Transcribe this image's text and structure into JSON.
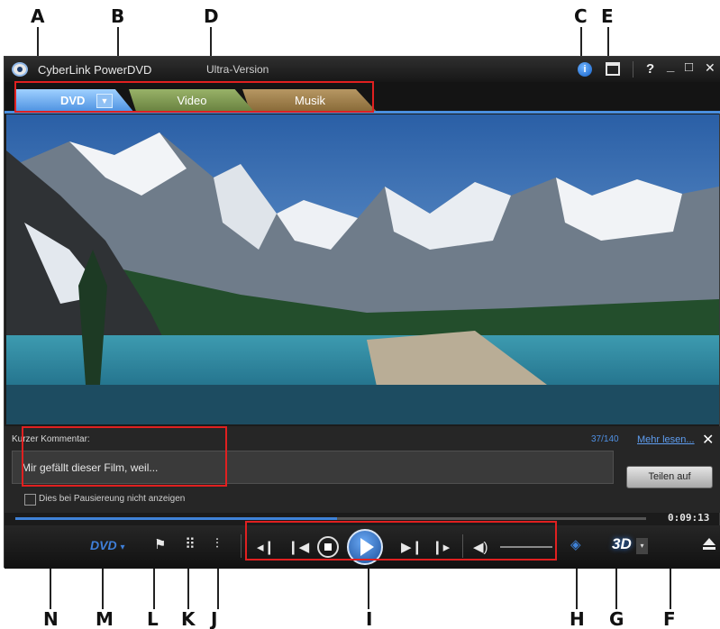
{
  "callouts": {
    "a": "A",
    "b": "B",
    "c": "C",
    "d": "D",
    "e": "E",
    "f": "F",
    "g": "G",
    "h": "H",
    "i": "I",
    "j": "J",
    "k": "K",
    "l": "L",
    "m": "M",
    "n": "N"
  },
  "titlebar": {
    "app_name": "CyberLink PowerDVD",
    "version": "Ultra-Version",
    "info_icon": "info-icon",
    "upgrade_icon": "upgrade-icon",
    "help_label": "?",
    "minimize_label": "_",
    "maximize_label": "□",
    "close_label": "✕"
  },
  "tabs": [
    {
      "label": "DVD",
      "active": true,
      "color": "#4a8fe0"
    },
    {
      "label": "Video",
      "active": false,
      "color": "#7d9850"
    },
    {
      "label": "Musik",
      "active": false,
      "color": "#a0804c"
    }
  ],
  "comment": {
    "label": "Kurzer Kommentar:",
    "count": "37/140",
    "more_link": "Mehr lesen...",
    "close_label": "✕",
    "text": "Mir gefällt dieser Film, weil...",
    "share_button": "Teilen auf",
    "hide_checkbox_label": "Dies bei Pausiereung nicht anzeigen",
    "hide_checked": false
  },
  "playback": {
    "progress_fraction": 0.51,
    "time": "0:09:13"
  },
  "controls": {
    "dvd_menu": "DVD",
    "dvd_menu_arrow": "▾",
    "threed_label": "3D",
    "threed_arrow": "▾"
  },
  "colors": {
    "accent_blue": "#4a8fe0",
    "annotation_red": "#e02020"
  }
}
